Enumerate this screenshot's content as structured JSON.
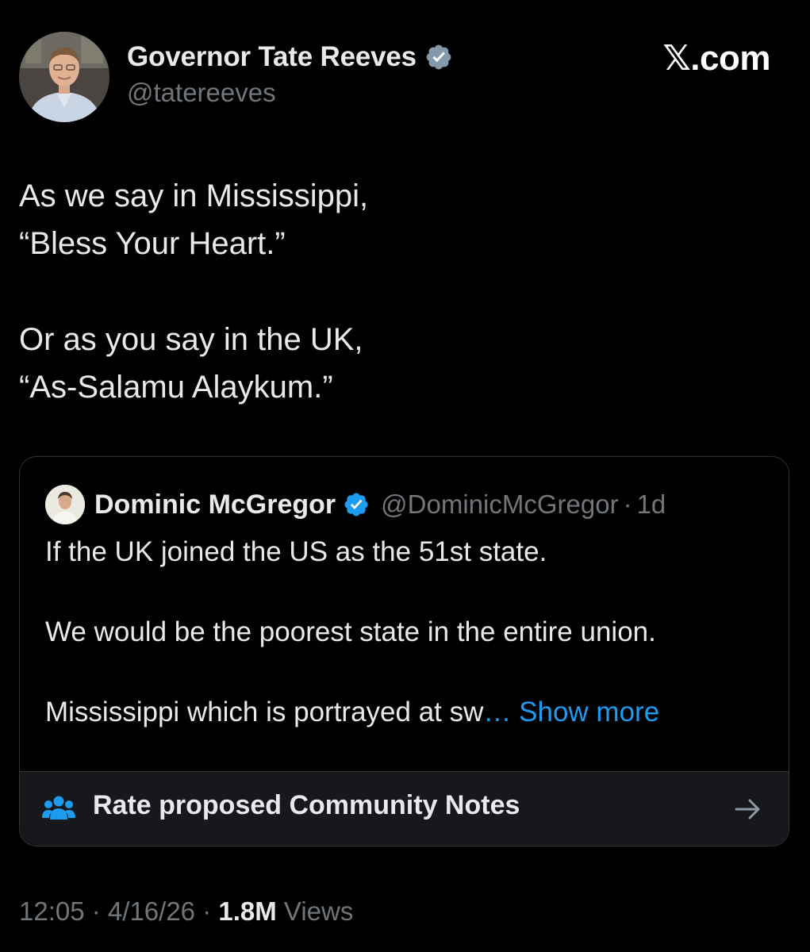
{
  "header": {
    "author_name": "Governor Tate Reeves",
    "author_handle": "@tatereeves",
    "site_label": "𝕏.com",
    "avatar_icon": "user-photo-avatar",
    "verified_icon": "verified-badge-icon"
  },
  "tweet": {
    "lines": [
      "As we say in Mississippi,",
      "“Bless Your Heart.”",
      "Or as you say in the UK,",
      "“As-Salamu Alaykum.”"
    ]
  },
  "quote": {
    "author_name": "Dominic McGregor",
    "author_handle": "@DominicMcGregor",
    "separator": "·",
    "time": "1d",
    "line1": "If the UK joined the US as the 51st state.",
    "line2": "We would be the poorest state in the entire union.",
    "line3": "Mississippi which is portrayed at sw",
    "ellipsis": "…",
    "show_more": "Show more"
  },
  "community_notes": {
    "label": "Rate proposed Community Notes",
    "icon": "people-group-icon",
    "arrow_icon": "arrow-right-icon"
  },
  "meta": {
    "time": "12:05",
    "sep1": " · ",
    "date": "4/16/26",
    "sep2": " · ",
    "views_count": "1.8M",
    "views_label": " Views"
  },
  "colors": {
    "background": "#000000",
    "text_primary": "#e7e9ea",
    "text_secondary": "#71767b",
    "accent_blue": "#1d9bf0",
    "verified_badge": "#829aab",
    "card_border": "#2f3336"
  }
}
